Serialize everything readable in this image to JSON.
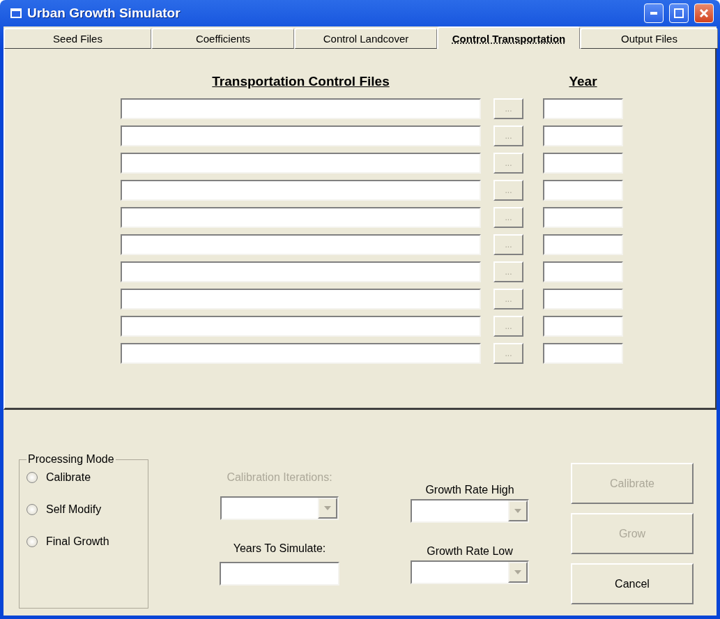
{
  "window": {
    "title": "Urban Growth Simulator"
  },
  "tabs": [
    {
      "label": "Seed Files",
      "selected": false
    },
    {
      "label": "Coefficients",
      "selected": false
    },
    {
      "label": "Control Landcover",
      "selected": false
    },
    {
      "label": "Control Transportation",
      "selected": true
    },
    {
      "label": "Output Files",
      "selected": false
    }
  ],
  "files": {
    "heading": "Transportation Control Files",
    "year_heading": "Year",
    "rows": [
      {
        "browse": "...",
        "browse_disabled": true
      },
      {
        "browse": "...",
        "browse_disabled": true
      },
      {
        "browse": "...",
        "browse_disabled": true
      },
      {
        "browse": "...",
        "browse_disabled": true
      },
      {
        "browse": "...",
        "browse_disabled": true
      },
      {
        "browse": "...",
        "browse_disabled": true
      },
      {
        "browse": "...",
        "browse_disabled": true
      },
      {
        "browse": "...",
        "browse_disabled": true
      },
      {
        "browse": "...",
        "browse_disabled": true
      },
      {
        "browse": "...",
        "browse_disabled": true
      }
    ]
  },
  "processing_mode": {
    "title": "Processing Mode",
    "options": [
      {
        "label": "Calibrate",
        "selected": false
      },
      {
        "label": "Self Modify",
        "selected": false
      },
      {
        "label": "Final Growth",
        "selected": false
      }
    ]
  },
  "calibration_iterations": {
    "label": "Calibration Iterations:",
    "disabled": true
  },
  "years_to_simulate": {
    "label": "Years To Simulate:"
  },
  "growth_rate_high": {
    "label": "Growth Rate High",
    "disabled": false
  },
  "growth_rate_low": {
    "label": "Growth Rate Low",
    "disabled": false
  },
  "buttons": [
    {
      "label": "Calibrate",
      "disabled": true
    },
    {
      "label": "Grow",
      "disabled": true
    },
    {
      "label": "Cancel",
      "disabled": false
    }
  ]
}
